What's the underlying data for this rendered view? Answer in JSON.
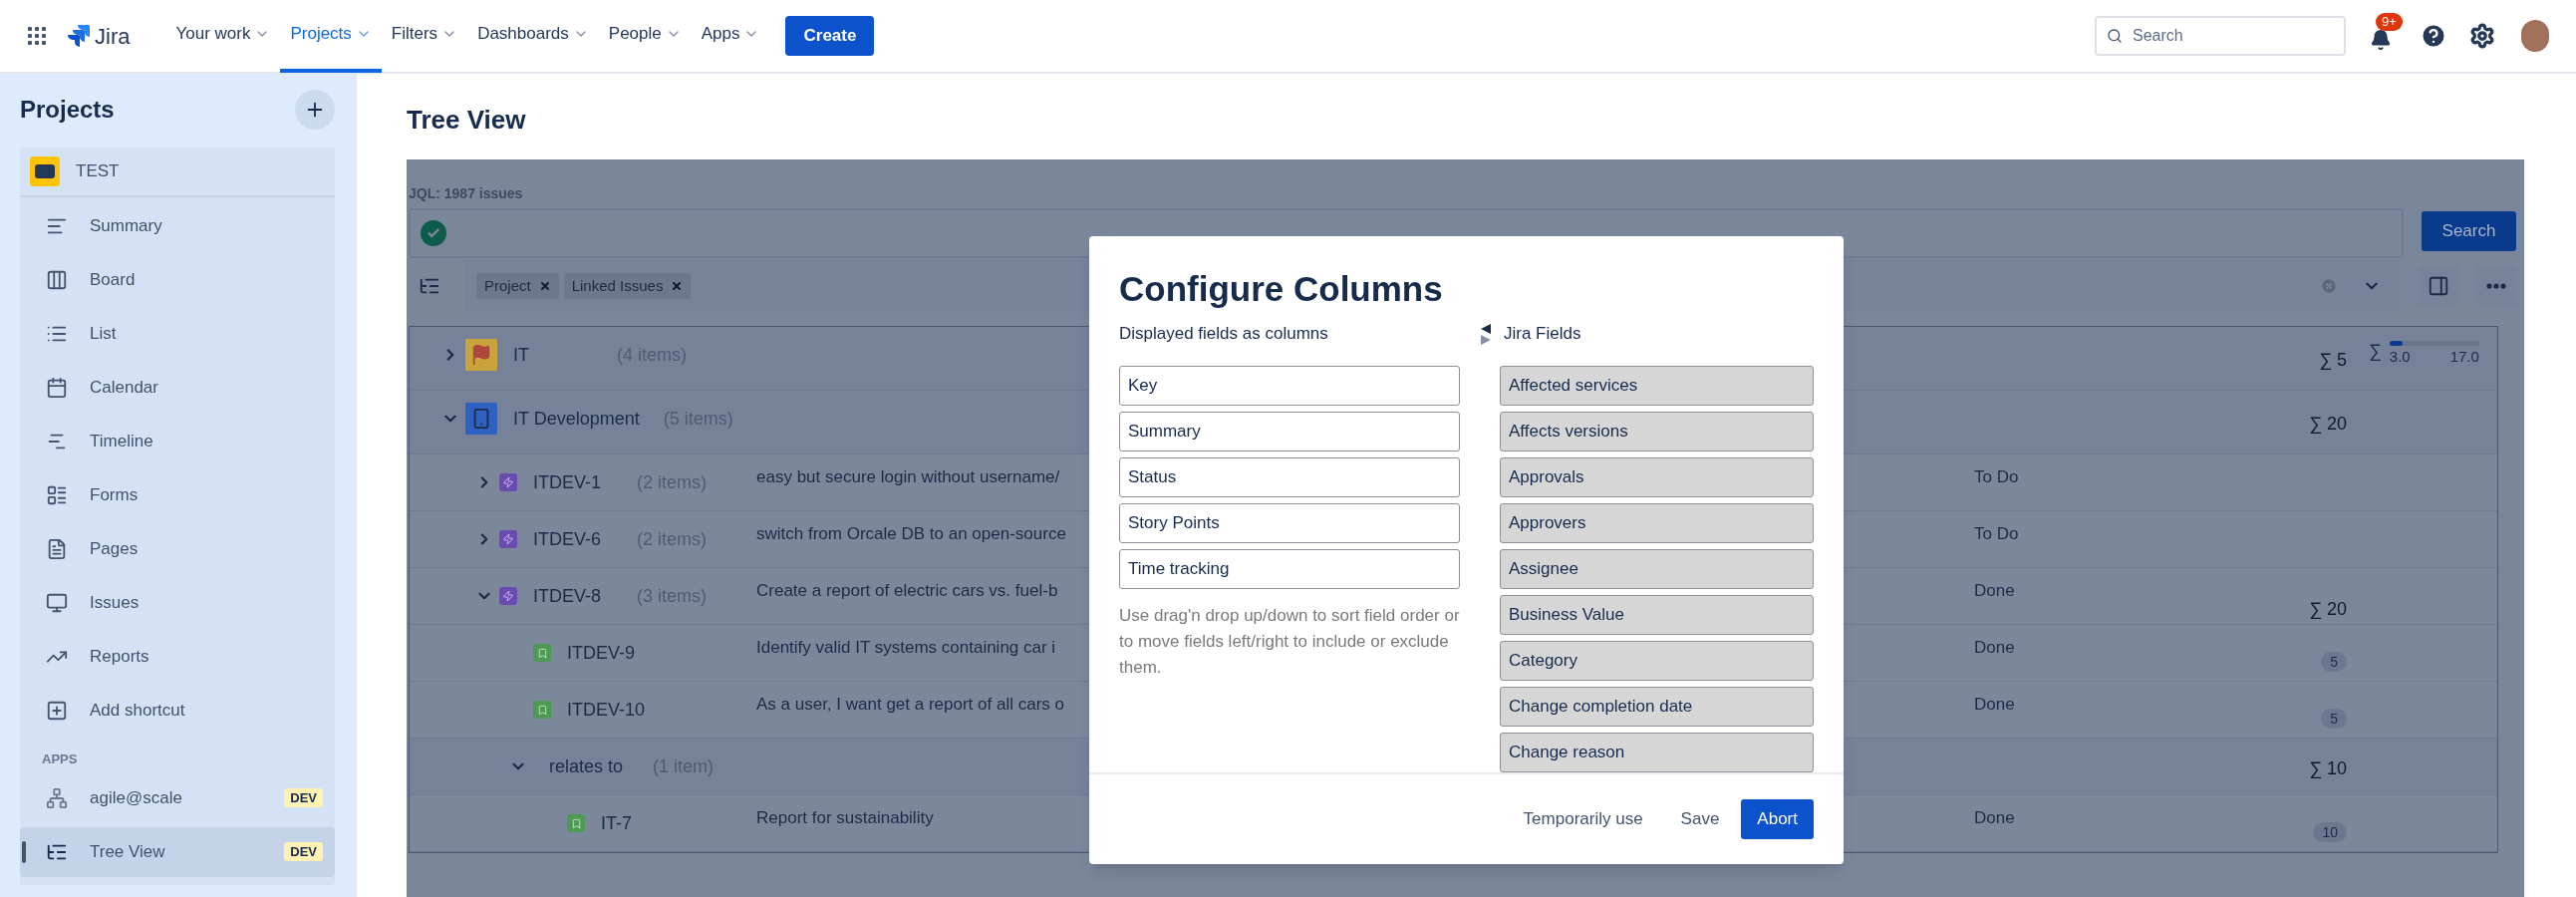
{
  "top_nav": {
    "app_name": "Jira",
    "menu": [
      {
        "label": "Your work",
        "selected": false
      },
      {
        "label": "Projects",
        "selected": true
      },
      {
        "label": "Filters",
        "selected": false
      },
      {
        "label": "Dashboards",
        "selected": false
      },
      {
        "label": "People",
        "selected": false
      },
      {
        "label": "Apps",
        "selected": false
      }
    ],
    "create_button": "Create",
    "search": {
      "placeholder": "Search"
    },
    "notifications_badge": "9+"
  },
  "sidebar": {
    "title": "Projects",
    "project": "TEST",
    "items": [
      {
        "label": "Summary",
        "selected": false
      },
      {
        "label": "Board",
        "selected": false
      },
      {
        "label": "List",
        "selected": false
      },
      {
        "label": "Calendar",
        "selected": false
      },
      {
        "label": "Timeline",
        "selected": false
      },
      {
        "label": "Forms",
        "selected": false
      },
      {
        "label": "Pages",
        "selected": false
      },
      {
        "label": "Issues",
        "selected": false
      },
      {
        "label": "Reports",
        "selected": false
      },
      {
        "label": "Add shortcut",
        "selected": false
      }
    ],
    "apps_heading": "APPS",
    "apps": [
      {
        "label": "agile@scale",
        "badge": "DEV",
        "selected": false
      },
      {
        "label": "Tree View",
        "badge": "DEV",
        "selected": true
      }
    ]
  },
  "page_title": "Tree View",
  "tree_view": {
    "jql_label": "JQL: 1987 issues",
    "search_button": "Search",
    "group_chips": [
      "Project",
      "Linked Issues"
    ],
    "rows": [
      {
        "kind": "project",
        "name": "IT",
        "count": "(4 items)",
        "color": "#c9a43c",
        "expanded": false,
        "points": "∑ 5",
        "points_badge": false,
        "time_tracking": {
          "sigma": "∑",
          "level": 0.15,
          "spent": "3.0",
          "remaining": "17.0"
        }
      },
      {
        "kind": "project",
        "name": "IT Development",
        "count": "(5 items)",
        "color": "#2f62c0",
        "expanded": true,
        "points": "∑ 20",
        "points_badge": false,
        "children": [
          {
            "kind": "epic",
            "name": "ITDEV-1",
            "count": "(2 items)",
            "expanded": false,
            "summary": "easy but secure login without username/",
            "status": "To Do"
          },
          {
            "kind": "epic",
            "name": "ITDEV-6",
            "count": "(2 items)",
            "expanded": false,
            "summary": "switch from Orcale DB to an open-source",
            "status": "To Do"
          },
          {
            "kind": "epic",
            "name": "ITDEV-8",
            "count": "(3 items)",
            "expanded": true,
            "summary": "Create a report of electric cars vs. fuel-b",
            "status": "Done",
            "points": "∑ 20",
            "points_badge": false,
            "children": [
              {
                "kind": "story",
                "name": "ITDEV-9",
                "summary": "Identify valid IT systems containing car i",
                "status": "Done",
                "points": "5",
                "points_badge": true
              },
              {
                "kind": "story",
                "name": "ITDEV-10",
                "summary": "As a user, I want get a report of all cars o",
                "status": "Done",
                "points": "5",
                "points_badge": true
              },
              {
                "kind": "link_group",
                "name": "relates to",
                "count": "(1 item)",
                "expanded": true,
                "points": "∑ 10",
                "points_badge": false,
                "children": [
                  {
                    "kind": "story",
                    "name": "IT-7",
                    "summary": "Report for sustainability",
                    "status": "Done",
                    "points": "10",
                    "points_badge": true
                  }
                ]
              }
            ]
          }
        ]
      }
    ]
  },
  "dialog": {
    "title": "Configure Columns",
    "left_heading": "Displayed fields as columns",
    "right_heading": "Jira Fields",
    "displayed_fields": [
      "Key",
      "Summary",
      "Status",
      "Story Points",
      "Time tracking"
    ],
    "hint": "Use drag'n drop up/down to sort field order or to move fields left/right to include or exclude them.",
    "available_fields": [
      "Affected services",
      "Affects versions",
      "Approvals",
      "Approvers",
      "Assignee",
      "Business Value",
      "Category",
      "Change completion date",
      "Change reason"
    ],
    "buttons": [
      {
        "label": "Temporarily use",
        "kind": "subtle"
      },
      {
        "label": "Save",
        "kind": "subtle"
      },
      {
        "label": "Abort",
        "kind": "primary"
      }
    ]
  }
}
